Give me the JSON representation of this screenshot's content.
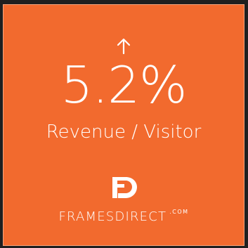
{
  "stat": {
    "arrow_icon": "arrow-up-icon",
    "value": "5.2%",
    "label": "Revenue / Visitor"
  },
  "brand": {
    "logo_icon": "framesdirect-fd-logo",
    "name_main": "FRAMESDIRECT",
    "name_suffix": ".COM"
  },
  "colors": {
    "background": "#f26a2e",
    "foreground": "#ffffff",
    "outer": "#1f1f1f"
  }
}
